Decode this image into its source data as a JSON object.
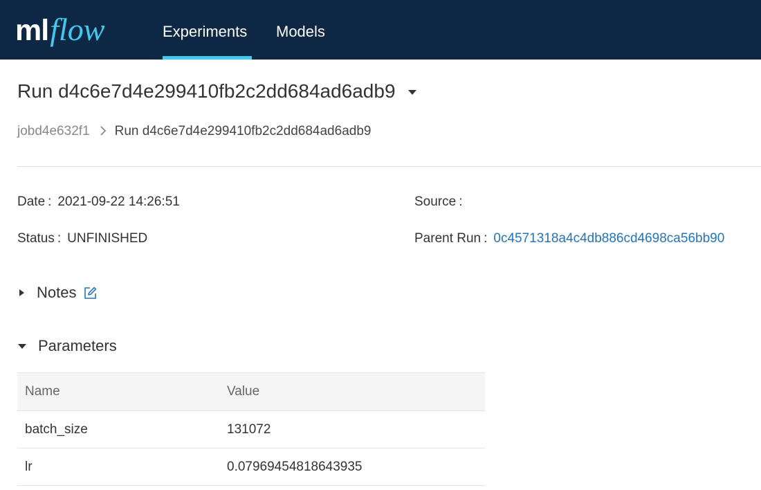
{
  "app": {
    "logo_ml": "ml",
    "logo_flow": "flow",
    "nav": [
      {
        "label": "Experiments"
      },
      {
        "label": "Models"
      }
    ],
    "active_nav": "Experiments"
  },
  "run": {
    "title": "Run d4c6e7d4e299410fb2c2dd684ad6adb9",
    "breadcrumb": {
      "experiment": "jobd4e632f1",
      "separator": ">",
      "current": "Run d4c6e7d4e299410fb2c2dd684ad6adb9"
    },
    "meta": {
      "date_label": "Date",
      "date_value": "2021-09-22 14:26:51",
      "status_label": "Status",
      "status_value": "UNFINISHED",
      "source_label": "Source",
      "source_value": "",
      "parent_label": "Parent Run",
      "parent_value": "0c4571318a4c4db886cd4698ca56bb90",
      "colon": ":"
    }
  },
  "sections": {
    "notes": {
      "title": "Notes",
      "expanded": false
    },
    "parameters": {
      "title": "Parameters",
      "expanded": true,
      "columns": [
        "Name",
        "Value"
      ],
      "rows": [
        {
          "name": "batch_size",
          "value": "131072"
        },
        {
          "name": "lr",
          "value": "0.07969454818643935"
        }
      ]
    }
  },
  "colors": {
    "header_bg": "#0e2745",
    "accent": "#43c9ed",
    "link": "#2374bb"
  },
  "icons": {
    "notes_edit": "edit-icon",
    "title_dropdown": "caret-down-icon"
  }
}
